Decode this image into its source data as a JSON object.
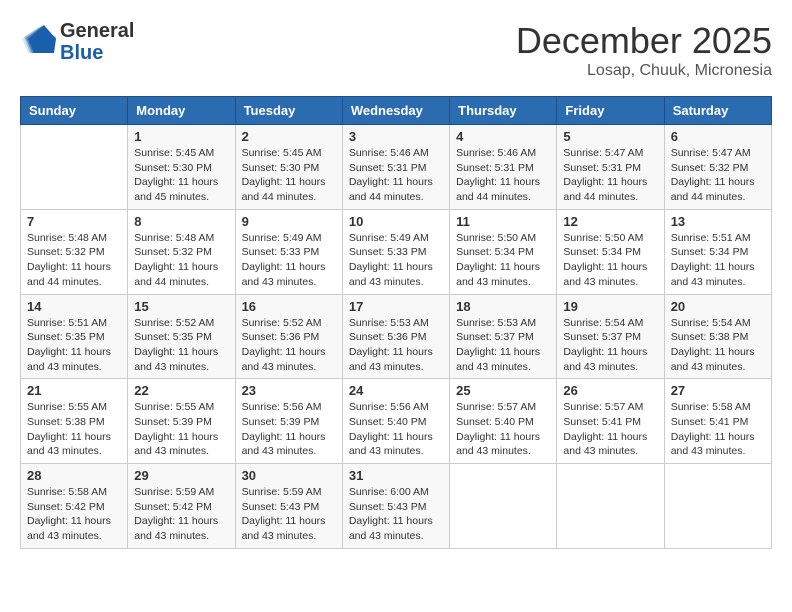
{
  "header": {
    "logo_general": "General",
    "logo_blue": "Blue",
    "month": "December 2025",
    "location": "Losap, Chuuk, Micronesia"
  },
  "days_of_week": [
    "Sunday",
    "Monday",
    "Tuesday",
    "Wednesday",
    "Thursday",
    "Friday",
    "Saturday"
  ],
  "weeks": [
    [
      {
        "day": "",
        "info": ""
      },
      {
        "day": "1",
        "info": "Sunrise: 5:45 AM\nSunset: 5:30 PM\nDaylight: 11 hours\nand 45 minutes."
      },
      {
        "day": "2",
        "info": "Sunrise: 5:45 AM\nSunset: 5:30 PM\nDaylight: 11 hours\nand 44 minutes."
      },
      {
        "day": "3",
        "info": "Sunrise: 5:46 AM\nSunset: 5:31 PM\nDaylight: 11 hours\nand 44 minutes."
      },
      {
        "day": "4",
        "info": "Sunrise: 5:46 AM\nSunset: 5:31 PM\nDaylight: 11 hours\nand 44 minutes."
      },
      {
        "day": "5",
        "info": "Sunrise: 5:47 AM\nSunset: 5:31 PM\nDaylight: 11 hours\nand 44 minutes."
      },
      {
        "day": "6",
        "info": "Sunrise: 5:47 AM\nSunset: 5:32 PM\nDaylight: 11 hours\nand 44 minutes."
      }
    ],
    [
      {
        "day": "7",
        "info": "Sunrise: 5:48 AM\nSunset: 5:32 PM\nDaylight: 11 hours\nand 44 minutes."
      },
      {
        "day": "8",
        "info": "Sunrise: 5:48 AM\nSunset: 5:32 PM\nDaylight: 11 hours\nand 44 minutes."
      },
      {
        "day": "9",
        "info": "Sunrise: 5:49 AM\nSunset: 5:33 PM\nDaylight: 11 hours\nand 43 minutes."
      },
      {
        "day": "10",
        "info": "Sunrise: 5:49 AM\nSunset: 5:33 PM\nDaylight: 11 hours\nand 43 minutes."
      },
      {
        "day": "11",
        "info": "Sunrise: 5:50 AM\nSunset: 5:34 PM\nDaylight: 11 hours\nand 43 minutes."
      },
      {
        "day": "12",
        "info": "Sunrise: 5:50 AM\nSunset: 5:34 PM\nDaylight: 11 hours\nand 43 minutes."
      },
      {
        "day": "13",
        "info": "Sunrise: 5:51 AM\nSunset: 5:34 PM\nDaylight: 11 hours\nand 43 minutes."
      }
    ],
    [
      {
        "day": "14",
        "info": "Sunrise: 5:51 AM\nSunset: 5:35 PM\nDaylight: 11 hours\nand 43 minutes."
      },
      {
        "day": "15",
        "info": "Sunrise: 5:52 AM\nSunset: 5:35 PM\nDaylight: 11 hours\nand 43 minutes."
      },
      {
        "day": "16",
        "info": "Sunrise: 5:52 AM\nSunset: 5:36 PM\nDaylight: 11 hours\nand 43 minutes."
      },
      {
        "day": "17",
        "info": "Sunrise: 5:53 AM\nSunset: 5:36 PM\nDaylight: 11 hours\nand 43 minutes."
      },
      {
        "day": "18",
        "info": "Sunrise: 5:53 AM\nSunset: 5:37 PM\nDaylight: 11 hours\nand 43 minutes."
      },
      {
        "day": "19",
        "info": "Sunrise: 5:54 AM\nSunset: 5:37 PM\nDaylight: 11 hours\nand 43 minutes."
      },
      {
        "day": "20",
        "info": "Sunrise: 5:54 AM\nSunset: 5:38 PM\nDaylight: 11 hours\nand 43 minutes."
      }
    ],
    [
      {
        "day": "21",
        "info": "Sunrise: 5:55 AM\nSunset: 5:38 PM\nDaylight: 11 hours\nand 43 minutes."
      },
      {
        "day": "22",
        "info": "Sunrise: 5:55 AM\nSunset: 5:39 PM\nDaylight: 11 hours\nand 43 minutes."
      },
      {
        "day": "23",
        "info": "Sunrise: 5:56 AM\nSunset: 5:39 PM\nDaylight: 11 hours\nand 43 minutes."
      },
      {
        "day": "24",
        "info": "Sunrise: 5:56 AM\nSunset: 5:40 PM\nDaylight: 11 hours\nand 43 minutes."
      },
      {
        "day": "25",
        "info": "Sunrise: 5:57 AM\nSunset: 5:40 PM\nDaylight: 11 hours\nand 43 minutes."
      },
      {
        "day": "26",
        "info": "Sunrise: 5:57 AM\nSunset: 5:41 PM\nDaylight: 11 hours\nand 43 minutes."
      },
      {
        "day": "27",
        "info": "Sunrise: 5:58 AM\nSunset: 5:41 PM\nDaylight: 11 hours\nand 43 minutes."
      }
    ],
    [
      {
        "day": "28",
        "info": "Sunrise: 5:58 AM\nSunset: 5:42 PM\nDaylight: 11 hours\nand 43 minutes."
      },
      {
        "day": "29",
        "info": "Sunrise: 5:59 AM\nSunset: 5:42 PM\nDaylight: 11 hours\nand 43 minutes."
      },
      {
        "day": "30",
        "info": "Sunrise: 5:59 AM\nSunset: 5:43 PM\nDaylight: 11 hours\nand 43 minutes."
      },
      {
        "day": "31",
        "info": "Sunrise: 6:00 AM\nSunset: 5:43 PM\nDaylight: 11 hours\nand 43 minutes."
      },
      {
        "day": "",
        "info": ""
      },
      {
        "day": "",
        "info": ""
      },
      {
        "day": "",
        "info": ""
      }
    ]
  ]
}
